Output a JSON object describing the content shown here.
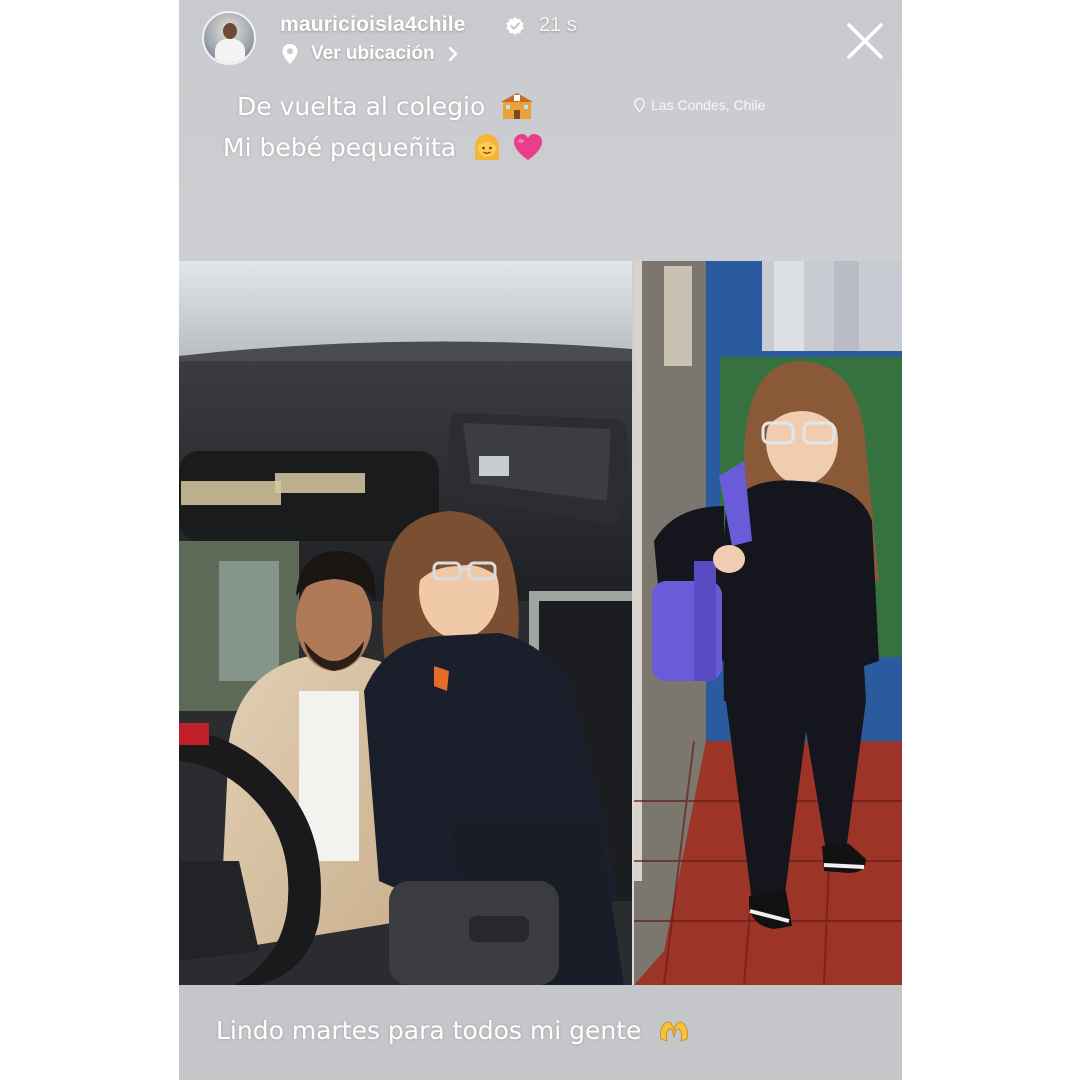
{
  "story": {
    "username": "mauricioisla4chile",
    "time": "21 s",
    "location_label": "Ver ubicación",
    "caption_line1": "De vuelta al colegio",
    "caption_line2": "Mi bebé pequeñita",
    "location_sticker": "Las Condes, Chile",
    "bottom_caption": "Lindo martes para todos mi gente"
  },
  "icons": {
    "verified": "verified-badge-icon",
    "close": "close-icon",
    "location": "location-pin-icon",
    "chevron": "chevron-right-icon"
  },
  "colors": {
    "text": "#ffffff",
    "background": "#d0d2d5",
    "heart": "#e83e8c",
    "backpack": "#6a5bd8"
  }
}
